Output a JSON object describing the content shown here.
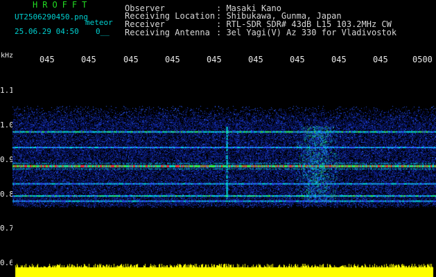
{
  "header": {
    "app_title": "HROFFT",
    "file_name": "UT2506290450.png",
    "mode": "meteor",
    "timestamp": "25.06.29 04:50",
    "counter": "0__",
    "info": [
      {
        "label": "Observer",
        "value": ": Masaki Kano"
      },
      {
        "label": "Receiving Location",
        "value": ": Shibukawa, Gunma, Japan"
      },
      {
        "label": "Receiver",
        "value": ": RTL-SDR SDR# 43dB L15 103.2MHz CW"
      },
      {
        "label": "Receiving Antenna",
        "value": ": 3el Yagi(V) Az 330 for Vladivostok"
      }
    ]
  },
  "axes": {
    "y_unit": "kHz",
    "y_ticks": [
      "1.1",
      "1.0",
      "0.9",
      "0.8",
      "0.7",
      "0.6"
    ],
    "y_values": [
      1.1,
      1.0,
      0.9,
      0.8,
      0.7,
      0.6
    ],
    "y_range": [
      0.6,
      1.16
    ],
    "time_ticks": [
      "045",
      "045",
      "045",
      "045",
      "045",
      "045",
      "045",
      "045",
      "045",
      "0500"
    ]
  },
  "colors": {
    "background": "#000000",
    "title": "#22dd22",
    "file_text": "#00d0d0",
    "info_text": "#d8d8d8",
    "noise": "#0a1a7a",
    "noise_bright": "#2a5aff",
    "line_cyan": "#00e0e0",
    "line_green": "#40ff40",
    "line_red": "#ff3030",
    "signal_strip": "#ffff00"
  },
  "chart_data": {
    "type": "heatmap",
    "y_unit": "kHz",
    "ylim": [
      0.6,
      1.16
    ],
    "signal_band": [
      0.78,
      1.0
    ],
    "carrier_lines": [
      {
        "freq": 0.985,
        "strength": "medium"
      },
      {
        "freq": 0.94,
        "strength": "weak"
      },
      {
        "freq": 0.885,
        "strength": "strong"
      },
      {
        "freq": 0.835,
        "strength": "weak"
      },
      {
        "freq": 0.8,
        "strength": "medium"
      },
      {
        "freq": 0.785,
        "strength": "weak"
      }
    ],
    "meteor_echo": {
      "time_fraction": 0.72,
      "freq_range": [
        0.78,
        1.0
      ]
    },
    "vertical_streak": {
      "time_fraction": 0.505,
      "freq_range": [
        0.79,
        1.0
      ]
    },
    "bottom_signal_level": "strong"
  }
}
